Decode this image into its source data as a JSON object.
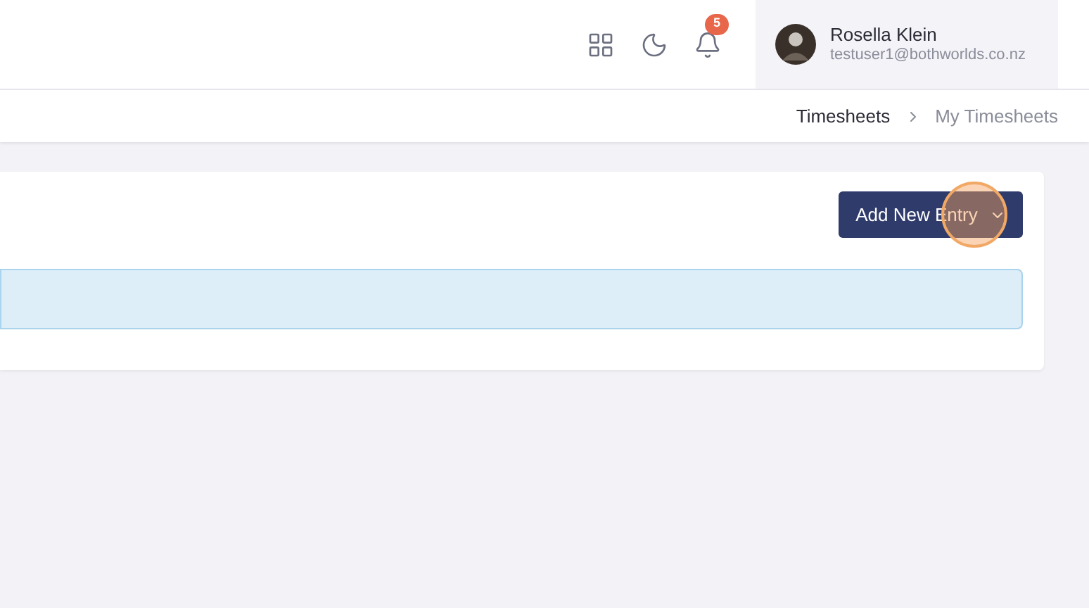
{
  "header": {
    "notifications": {
      "count": "5"
    },
    "user": {
      "name": "Rosella Klein",
      "email": "testuser1@bothworlds.co.nz"
    }
  },
  "breadcrumb": [
    {
      "label": "Timesheets",
      "current": false
    },
    {
      "label": "My Timesheets",
      "current": true
    }
  ],
  "card": {
    "button": {
      "label": "Add New Entry"
    }
  }
}
